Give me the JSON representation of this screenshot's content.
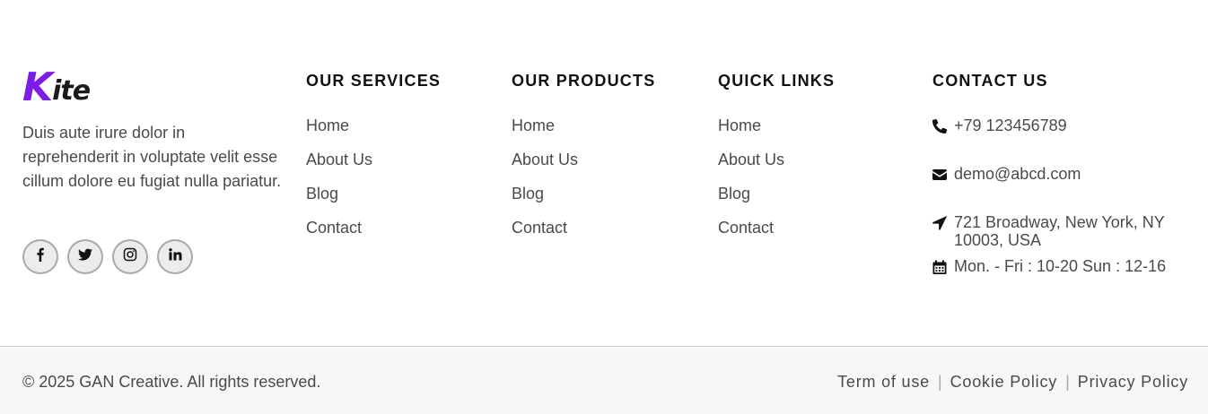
{
  "brand": {
    "logo_initial": "K",
    "logo_rest": "ite",
    "logo_accent_color": "#7b1ce8",
    "description": "Duis aute irure dolor in reprehenderit in voluptate velit esse cillum dolore eu fugiat nulla pariatur."
  },
  "social": [
    {
      "name": "facebook-icon"
    },
    {
      "name": "twitter-icon"
    },
    {
      "name": "instagram-icon"
    },
    {
      "name": "linkedin-icon"
    }
  ],
  "services": {
    "title": "OUR SERVICES",
    "links": [
      "Home",
      "About Us",
      "Blog",
      "Contact"
    ]
  },
  "products": {
    "title": "OUR PRODUCTS",
    "links": [
      "Home",
      "About Us",
      "Blog",
      "Contact"
    ]
  },
  "quick_links": {
    "title": "QUICK LINKS",
    "links": [
      "Home",
      "About Us",
      "Blog",
      "Contact"
    ]
  },
  "contact": {
    "title": "CONTACT US",
    "phone": "+79 123456789",
    "email": "demo@abcd.com",
    "address": "721 Broadway, New York, NY 10003, USA",
    "hours": "Mon. - Fri : 10-20 Sun : 12-16",
    "icons": [
      "phone-icon",
      "envelope-icon",
      "location-arrow-icon",
      "calendar-icon"
    ]
  },
  "bottom": {
    "copyright": "© 2025 GAN Creative. All rights reserved.",
    "legal_links": [
      "Term of use",
      "Cookie Policy",
      "Privacy Policy"
    ],
    "separator": "|"
  }
}
